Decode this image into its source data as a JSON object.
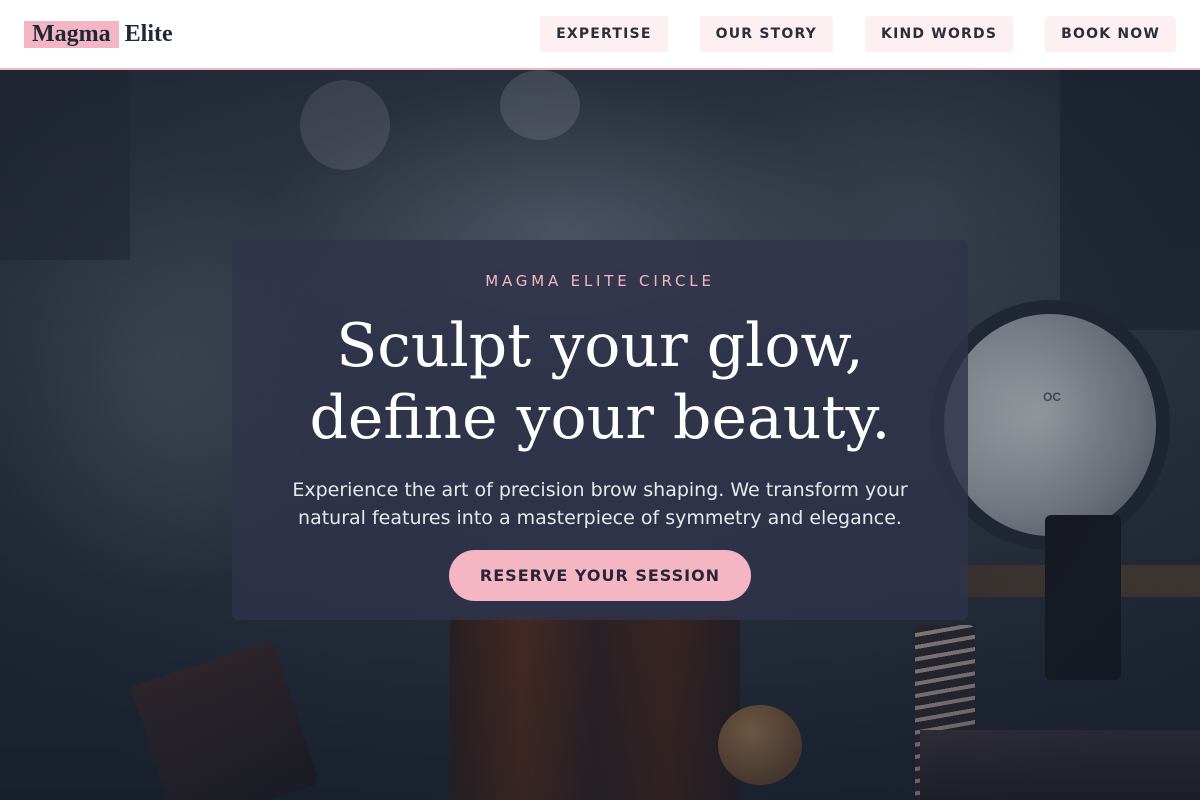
{
  "header": {
    "logo_highlight": "Magma",
    "logo_rest": "Elite",
    "nav": [
      {
        "label": "EXPERTISE"
      },
      {
        "label": "OUR STORY"
      },
      {
        "label": "KIND WORDS"
      },
      {
        "label": "BOOK NOW"
      }
    ]
  },
  "hero": {
    "eyebrow": "MAGMA ELITE CIRCLE",
    "headline_line1": "Sculpt your glow,",
    "headline_line2": "define your beauty.",
    "lead_line1": "Experience the art of precision brow shaping. We transform your",
    "lead_line2": "natural features into a masterpiece of symmetry and elegance.",
    "cta_label": "RESERVE YOUR SESSION",
    "background_mirror_text": "OC"
  },
  "colors": {
    "accent_pink": "#f4b6c2",
    "nav_button_bg": "#fcf0f3",
    "card_bg": "#2f334b",
    "text_dark": "#1f2838"
  }
}
